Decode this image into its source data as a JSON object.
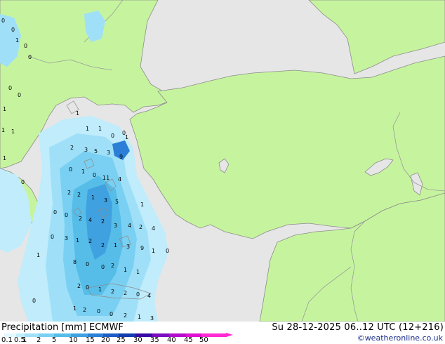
{
  "header": {
    "title": "Precipitation [mm] ECMWF",
    "datetime": "Su 28-12-2025 06..12 UTC (12+216)",
    "credit": "©weatheronline.co.uk"
  },
  "legend": {
    "labels": [
      "0.1",
      "0.5",
      "1",
      "2",
      "5",
      "10",
      "15",
      "20",
      "25",
      "30",
      "35",
      "40",
      "45",
      "50"
    ],
    "colors": [
      "#e2f7ff",
      "#c0ecfb",
      "#9fe0f8",
      "#7ad0f2",
      "#56bde9",
      "#3fa1e0",
      "#2b7fd6",
      "#1e5cc8",
      "#123cb0",
      "#3a0aa8",
      "#7b0cc0",
      "#b30ccd",
      "#e010d2",
      "#ff2ad2"
    ]
  },
  "colors": {
    "land": "#c6f49e",
    "sea": "#e6e6e6",
    "border": "#9a9a9a",
    "coast": "#8c8c8c"
  },
  "precip_values": [
    {
      "v": "0"
    },
    {
      "v": "0"
    },
    {
      "v": "1"
    },
    {
      "v": "0"
    },
    {
      "v": "0"
    },
    {
      "v": "0"
    },
    {
      "v": "0"
    },
    {
      "v": "1"
    },
    {
      "v": "1"
    },
    {
      "v": "1"
    },
    {
      "v": "1"
    },
    {
      "v": "0"
    },
    {
      "v": "0"
    },
    {
      "v": "1"
    },
    {
      "v": "1"
    },
    {
      "v": "0"
    },
    {
      "v": "0"
    },
    {
      "v": "1"
    },
    {
      "v": "2"
    },
    {
      "v": "3"
    },
    {
      "v": "5"
    },
    {
      "v": "3"
    },
    {
      "v": "9"
    },
    {
      "v": "1"
    },
    {
      "v": "0"
    },
    {
      "v": "1"
    },
    {
      "v": "0"
    },
    {
      "v": "11"
    },
    {
      "v": "4"
    },
    {
      "v": "2"
    },
    {
      "v": "2"
    },
    {
      "v": "1"
    },
    {
      "v": "3"
    },
    {
      "v": "5"
    },
    {
      "v": "1"
    },
    {
      "v": "0"
    },
    {
      "v": "2"
    },
    {
      "v": "4"
    },
    {
      "v": "2"
    },
    {
      "v": "3"
    },
    {
      "v": "4"
    },
    {
      "v": "2"
    },
    {
      "v": "4"
    },
    {
      "v": "3"
    },
    {
      "v": "1"
    },
    {
      "v": "2"
    },
    {
      "v": "2"
    },
    {
      "v": "1"
    },
    {
      "v": "3"
    },
    {
      "v": "9"
    },
    {
      "v": "1"
    },
    {
      "v": "0"
    },
    {
      "v": "0"
    },
    {
      "v": "1"
    },
    {
      "v": "0"
    },
    {
      "v": "0"
    },
    {
      "v": "2"
    },
    {
      "v": "1"
    },
    {
      "v": "1"
    },
    {
      "v": "8"
    },
    {
      "v": "2"
    },
    {
      "v": "0"
    },
    {
      "v": "1"
    },
    {
      "v": "2"
    },
    {
      "v": "2"
    },
    {
      "v": "0"
    },
    {
      "v": "4"
    },
    {
      "v": "2"
    },
    {
      "v": "0"
    },
    {
      "v": "0"
    },
    {
      "v": "2"
    },
    {
      "v": "1"
    },
    {
      "v": "3"
    },
    {
      "v": "1"
    },
    {
      "v": "0"
    }
  ]
}
